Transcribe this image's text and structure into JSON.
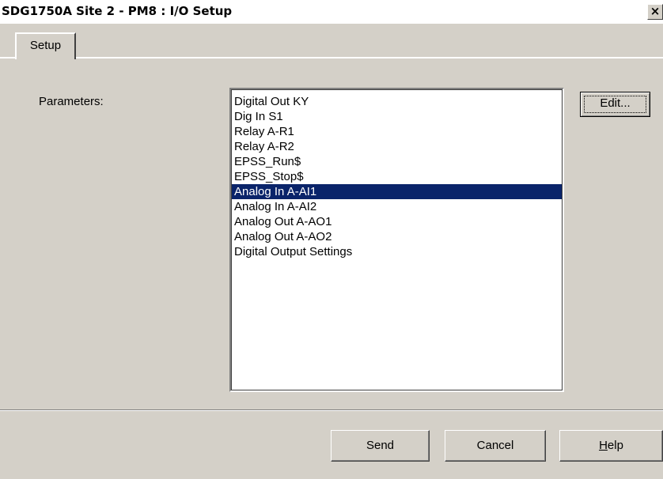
{
  "window": {
    "title": "SDG1750A Site 2 - PM8 : I/O Setup",
    "close_label": "×"
  },
  "tabs": [
    {
      "label": "Setup",
      "active": true
    }
  ],
  "parameters": {
    "label": "Parameters:",
    "items": [
      "Digital Out KY",
      "Dig In S1",
      "Relay A-R1",
      "Relay A-R2",
      "EPSS_Run$",
      "EPSS_Stop$",
      "Analog In A-AI1",
      "Analog In A-AI2",
      "Analog Out A-AO1",
      "Analog Out A-AO2",
      "Digital Output Settings"
    ],
    "selected": "Analog In A-AI1"
  },
  "edit_button": {
    "label": "Edit..."
  },
  "footer": {
    "send_label": "Send",
    "cancel_label": "Cancel",
    "help_label_prefix": "H",
    "help_label_rest": "elp"
  },
  "colors": {
    "dialog_bg": "#d4d0c8",
    "selection_bg": "#0a246a",
    "selection_fg": "#ffffff"
  }
}
